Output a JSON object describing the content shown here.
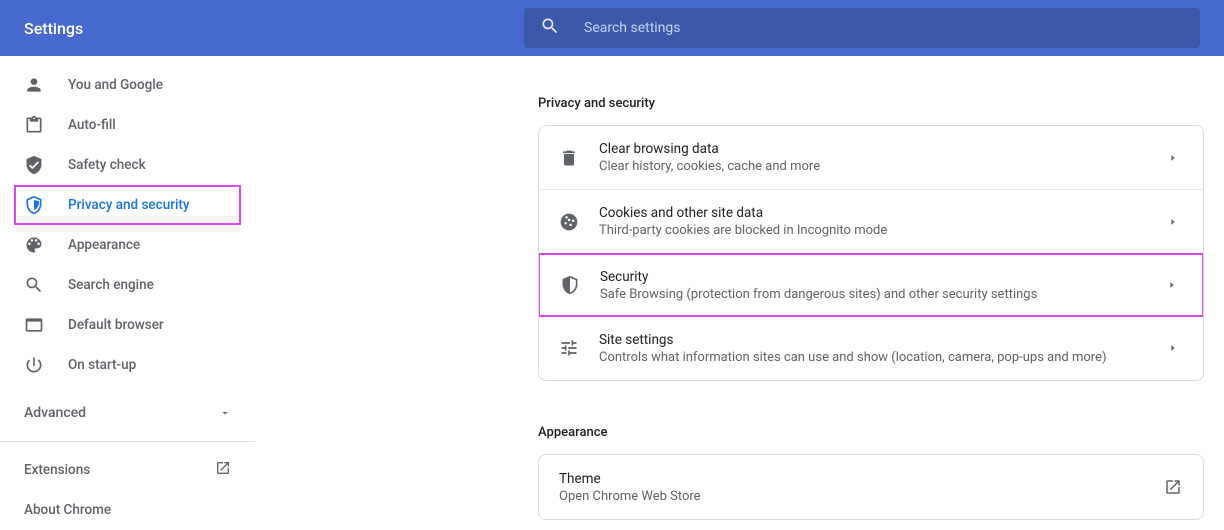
{
  "header": {
    "title": "Settings",
    "search_placeholder": "Search settings"
  },
  "sidebar": {
    "items": [
      {
        "label": "You and Google"
      },
      {
        "label": "Auto-fill"
      },
      {
        "label": "Safety check"
      },
      {
        "label": "Privacy and security"
      },
      {
        "label": "Appearance"
      },
      {
        "label": "Search engine"
      },
      {
        "label": "Default browser"
      },
      {
        "label": "On start-up"
      }
    ],
    "advanced": "Advanced",
    "extensions": "Extensions",
    "about": "About Chrome"
  },
  "privacy": {
    "heading": "Privacy and security",
    "rows": [
      {
        "title": "Clear browsing data",
        "sub": "Clear history, cookies, cache and more"
      },
      {
        "title": "Cookies and other site data",
        "sub": "Third-party cookies are blocked in Incognito mode"
      },
      {
        "title": "Security",
        "sub": "Safe Browsing (protection from dangerous sites) and other security settings"
      },
      {
        "title": "Site settings",
        "sub": "Controls what information sites can use and show (location, camera, pop-ups and more)"
      }
    ]
  },
  "appearance": {
    "heading": "Appearance",
    "rows": [
      {
        "title": "Theme",
        "sub": "Open Chrome Web Store"
      }
    ]
  }
}
